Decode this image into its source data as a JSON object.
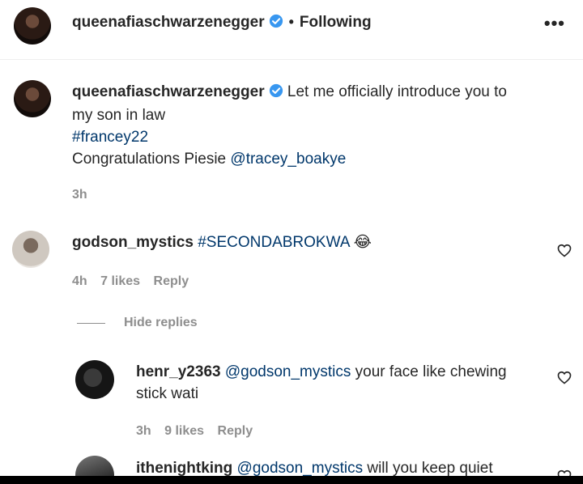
{
  "header": {
    "username": "queenafiaschwarzenegger",
    "separator": "•",
    "follow_status": "Following",
    "more_label": "•••"
  },
  "post": {
    "username": "queenafiaschwarzenegger",
    "caption_line1_text": "Let me officially introduce you to",
    "caption_line2": "my son in law",
    "hashtag": "#francey22",
    "congrats_text": "Congratulations Piesie",
    "mention": "@tracey_boakye",
    "time": "3h"
  },
  "comments": [
    {
      "username": "godson_mystics",
      "text": "#SECONDABROKWA",
      "emoji": "😂",
      "time": "4h",
      "likes": "7 likes",
      "reply_label": "Reply",
      "hide_replies": "Hide replies"
    }
  ],
  "replies": [
    {
      "username": "henr_y2363",
      "mention": "@godson_mystics",
      "text_line1": "your face like chewing",
      "text_line2": "stick wati",
      "time": "3h",
      "likes": "9 likes",
      "reply_label": "Reply"
    },
    {
      "username": "ithenightking",
      "mention": "@godson_mystics",
      "text_line1": "will you keep quiet"
    }
  ],
  "colors": {
    "link": "#00376b",
    "verified": "#3897f0",
    "muted": "#8e8e8e"
  }
}
